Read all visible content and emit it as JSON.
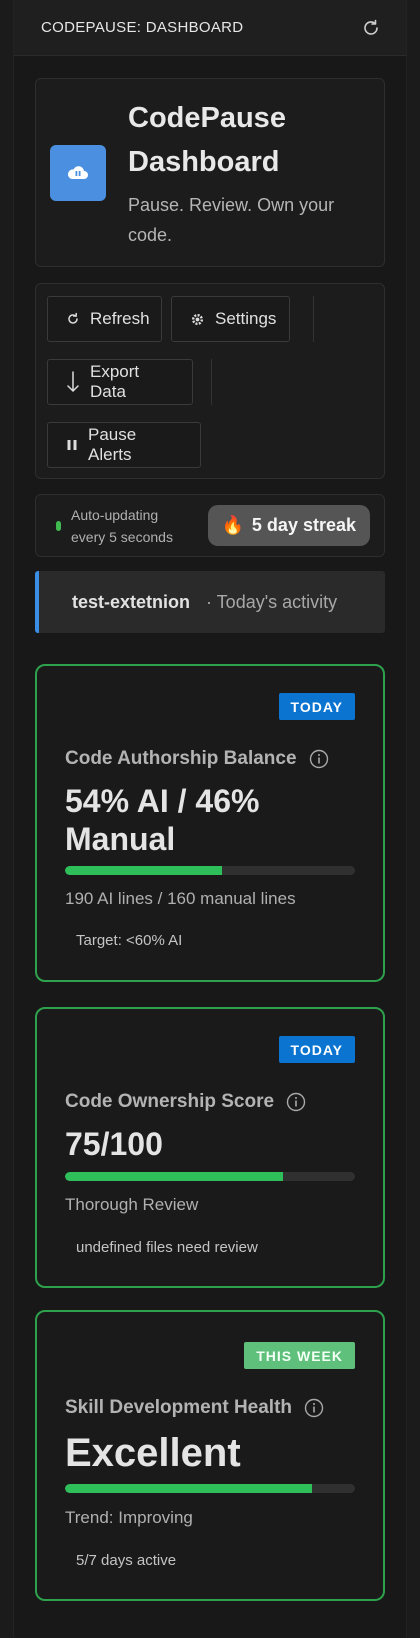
{
  "header": {
    "title": "CODEPAUSE: DASHBOARD"
  },
  "hero": {
    "title_line1": "CodePause",
    "title_line2": "Dashboard",
    "tagline_line1": "Pause. Review. Own your",
    "tagline_line2": "code."
  },
  "actions": {
    "refresh": "Refresh",
    "settings": "Settings",
    "export": "Export Data",
    "pause": "Pause Alerts"
  },
  "status": {
    "line1": "Auto-updating",
    "line2": "every 5 seconds",
    "streak": "5 day streak"
  },
  "activity": {
    "project": "test-extetnion",
    "subtitle": "· Today's activity"
  },
  "metrics": [
    {
      "badge": "TODAY",
      "label": "Code Authorship Balance",
      "value_line1": "54% AI / 46%",
      "value_line2": "Manual",
      "progress": 0.54,
      "detail": "190 AI lines / 160 manual lines",
      "note": "Target: <60% AI"
    },
    {
      "badge": "TODAY",
      "label": "Code Ownership Score",
      "value": "75/100",
      "progress": 0.75,
      "detail": "Thorough Review",
      "note": "undefined files need review"
    },
    {
      "badge": "THIS WEEK",
      "label": "Skill Development Health",
      "value": "Excellent",
      "progress": 0.85,
      "detail": "Trend: Improving",
      "note": "5/7 days active"
    }
  ],
  "colors": {
    "accent_blue": "#0b74d0",
    "progress_green": "#2fbf5a",
    "card_border_green": "#2ea14d",
    "logo_blue": "#4a8fe0"
  }
}
